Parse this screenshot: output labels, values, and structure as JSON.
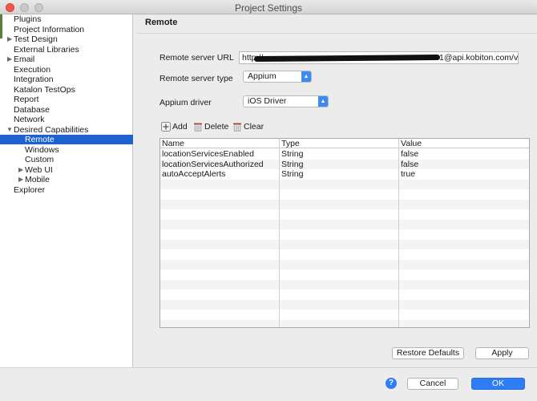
{
  "window": {
    "title": "Project Settings"
  },
  "sidebar": {
    "items": [
      {
        "label": "Plugins",
        "arrow": ""
      },
      {
        "label": "Project Information",
        "arrow": ""
      },
      {
        "label": "Test Design",
        "arrow": "▶"
      },
      {
        "label": "External Libraries",
        "arrow": ""
      },
      {
        "label": "Email",
        "arrow": "▶"
      },
      {
        "label": "Execution",
        "arrow": ""
      },
      {
        "label": "Integration",
        "arrow": ""
      },
      {
        "label": "Katalon TestOps",
        "arrow": ""
      },
      {
        "label": "Report",
        "arrow": ""
      },
      {
        "label": "Database",
        "arrow": ""
      },
      {
        "label": "Network",
        "arrow": ""
      },
      {
        "label": "Desired Capabilities",
        "arrow": "▼"
      },
      {
        "label": "Remote",
        "arrow": "",
        "selected": true
      },
      {
        "label": "Windows",
        "arrow": ""
      },
      {
        "label": "Custom",
        "arrow": ""
      },
      {
        "label": "Web UI",
        "arrow": "▶"
      },
      {
        "label": "Mobile",
        "arrow": "▶"
      },
      {
        "label": "Explorer",
        "arrow": ""
      }
    ]
  },
  "panel": {
    "title": "Remote",
    "url_label": "Remote server URL",
    "url_prefix": "http://",
    "url_suffix": "1@api.kobiton.com/v",
    "server_type_label": "Remote server type",
    "server_type_value": "Appium",
    "driver_label": "Appium driver",
    "driver_value": "iOS Driver"
  },
  "toolbar": {
    "add": "Add",
    "delete": "Delete",
    "clear": "Clear"
  },
  "table": {
    "headers": [
      "Name",
      "Type",
      "Value"
    ],
    "rows": [
      [
        "locationServicesEnabled",
        "String",
        "false"
      ],
      [
        "locationServicesAuthorized",
        "String",
        "false"
      ],
      [
        "autoAcceptAlerts",
        "String",
        "true"
      ]
    ]
  },
  "buttons": {
    "restore_defaults": "Restore Defaults",
    "apply": "Apply",
    "cancel": "Cancel",
    "ok": "OK",
    "help": "?"
  },
  "colors": {
    "selection": "#1e62d0",
    "accent": "#2e7cf6"
  }
}
